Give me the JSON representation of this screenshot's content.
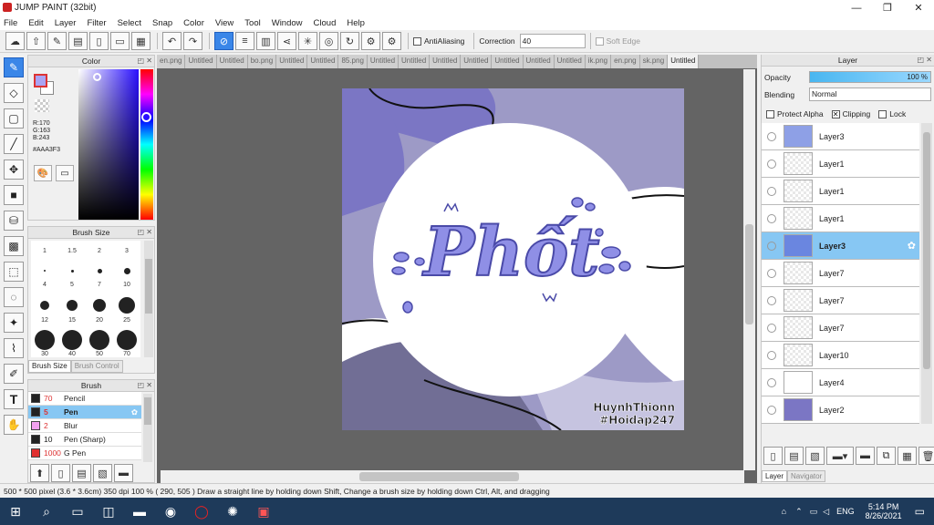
{
  "window": {
    "title": "JUMP PAINT (32bit)",
    "controls": [
      "—",
      "❐",
      "✕"
    ]
  },
  "menu": [
    "File",
    "Edit",
    "Layer",
    "Filter",
    "Select",
    "Snap",
    "Color",
    "View",
    "Tool",
    "Window",
    "Cloud",
    "Help"
  ],
  "toolbar": {
    "antialiasing_label": "AntiAliasing",
    "correction_label": "Correction",
    "correction_value": "40",
    "softedge_label": "Soft Edge"
  },
  "color_panel": {
    "title": "Color",
    "r": "R:170",
    "g": "G:163",
    "b": "B:243",
    "hex": "#AAA3F3",
    "current_color": "#aaa3f3"
  },
  "brush_size_panel": {
    "title": "Brush Size",
    "sizes": [
      "1",
      "1.5",
      "2",
      "3",
      "4",
      "5",
      "7",
      "10",
      "12",
      "15",
      "20",
      "25",
      "30",
      "40",
      "50",
      "70"
    ],
    "tabs": [
      "Brush Size",
      "Brush Control"
    ]
  },
  "brush_panel": {
    "title": "Brush",
    "items": [
      {
        "size": "70",
        "name": "Pencil",
        "color": "#222222"
      },
      {
        "size": "5",
        "name": "Pen",
        "color": "#222222"
      },
      {
        "size": "2",
        "name": "Blur",
        "color": "#f2a0f0"
      },
      {
        "size": "10",
        "name": "Pen (Sharp)",
        "color": "#222222"
      },
      {
        "size": "1000",
        "name": "G Pen",
        "color": "#e03030"
      }
    ]
  },
  "tabs": [
    "en.png",
    "Untitled",
    "Untitled",
    "bo.png",
    "Untitled",
    "Untitled",
    "85.png",
    "Untitled",
    "Untitled",
    "Untitled",
    "Untitled",
    "Untitled",
    "Untitled",
    "Untitled",
    "ik.png",
    "en.png",
    "sk.png",
    "Untitled"
  ],
  "artwork": {
    "text": "Phốt",
    "signature_line1": "HuynhThionn",
    "signature_line2": "#Hoidap247",
    "bg_color": "#9d9ac6",
    "dark_color": "#7b76c4"
  },
  "layer_panel": {
    "title": "Layer",
    "opacity_label": "Opacity",
    "opacity_value": "100 %",
    "blending_label": "Blending",
    "blending_value": "Normal",
    "protect_alpha": "Protect Alpha",
    "clipping": "Clipping",
    "lock": "Lock",
    "layers": [
      "Layer3",
      "Layer1",
      "Layer1",
      "Layer1",
      "Layer3",
      "Layer7",
      "Layer7",
      "Layer7",
      "Layer10",
      "Layer4",
      "Layer2"
    ],
    "tabs": [
      "Layer",
      "Navigator"
    ]
  },
  "status": {
    "text": "500 * 500 pixel  (3.6 * 3.6cm)  350 dpi  100 %  ( 290, 505 )  Draw a straight line by holding down Shift, Change a brush size by holding down Ctrl, Alt, and dragging"
  },
  "taskbar": {
    "lang": "ENG",
    "time": "5:14 PM",
    "date": "8/26/2021"
  }
}
